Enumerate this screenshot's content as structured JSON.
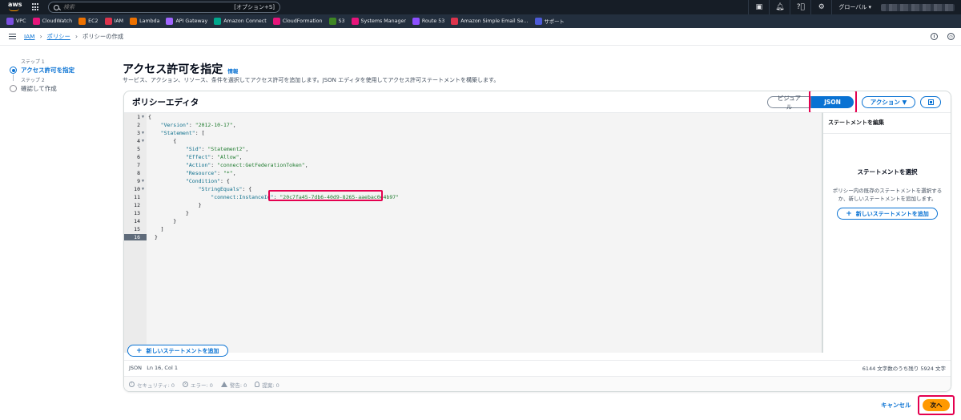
{
  "topbar": {
    "logo": "aws",
    "search_placeholder": "検索",
    "search_shortcut": "[オプション+S]",
    "region": "グローバル ▾"
  },
  "favorites": [
    {
      "label": "VPC",
      "color": "#7b4fe0"
    },
    {
      "label": "CloudWatch",
      "color": "#e7157b"
    },
    {
      "label": "EC2",
      "color": "#ed7100"
    },
    {
      "label": "IAM",
      "color": "#dd344c"
    },
    {
      "label": "Lambda",
      "color": "#ed7100"
    },
    {
      "label": "API Gateway",
      "color": "#a166ff"
    },
    {
      "label": "Amazon Connect",
      "color": "#01a88d"
    },
    {
      "label": "CloudFormation",
      "color": "#e7157b"
    },
    {
      "label": "S3",
      "color": "#3f8624"
    },
    {
      "label": "Systems Manager",
      "color": "#e7157b"
    },
    {
      "label": "Route 53",
      "color": "#8c4fff"
    },
    {
      "label": "Amazon Simple Email Se...",
      "color": "#dd344c"
    },
    {
      "label": "サポート",
      "color": "#4d5bd8"
    }
  ],
  "breadcrumb": {
    "items": [
      "IAM",
      "ポリシー"
    ],
    "current": "ポリシーの作成"
  },
  "steps": {
    "step1_small": "ステップ 1",
    "step1_title": "アクセス許可を指定",
    "step2_small": "ステップ 2",
    "step2_title": "確認して作成"
  },
  "page": {
    "title": "アクセス許可を指定",
    "info_link": "情報",
    "description": "サービス、アクション、リソース、条件を選択してアクセス許可を追加します。JSON エディタを使用してアクセス許可ステートメントを構築します。"
  },
  "editor": {
    "title": "ポリシーエディタ",
    "visual_label": "ビジュアル",
    "json_label": "JSON",
    "actions_label": "アクション ▼",
    "lines": [
      {
        "n": "1",
        "fold": "▼",
        "text": "{"
      },
      {
        "n": "2",
        "fold": "",
        "text": "    \"Version\": \"2012-10-17\","
      },
      {
        "n": "3",
        "fold": "▼",
        "text": "    \"Statement\": ["
      },
      {
        "n": "4",
        "fold": "▼",
        "text": "        {"
      },
      {
        "n": "5",
        "fold": "",
        "text": "            \"Sid\": \"Statement2\","
      },
      {
        "n": "6",
        "fold": "",
        "text": "            \"Effect\": \"Allow\","
      },
      {
        "n": "7",
        "fold": "",
        "text": "            \"Action\": \"connect:GetFederationToken\","
      },
      {
        "n": "8",
        "fold": "",
        "text": "            \"Resource\": \"*\","
      },
      {
        "n": "9",
        "fold": "▼",
        "text": "            \"Condition\": {"
      },
      {
        "n": "10",
        "fold": "▼",
        "text": "                \"StringEquals\": {"
      },
      {
        "n": "11",
        "fold": "",
        "text": "                    \"connect:InstanceId\": \"20c7fa45-7db6-40d9-8265-aaebac0e4b97\""
      },
      {
        "n": "12",
        "fold": "",
        "text": "                }"
      },
      {
        "n": "13",
        "fold": "",
        "text": "            }"
      },
      {
        "n": "14",
        "fold": "",
        "text": "        }"
      },
      {
        "n": "15",
        "fold": "",
        "text": "    ]"
      },
      {
        "n": "16",
        "fold": "",
        "text": "}"
      }
    ],
    "active_line": "16",
    "add_statement_label": "新しいステートメントを追加",
    "status_left": "JSON   Ln 16, Col 1",
    "status_right": "6144 文字数のうち残り 5924 文字",
    "diagnostics": {
      "security": "セキュリティ: 0",
      "errors": "エラー: 0",
      "warnings": "警告: 0",
      "suggestions": "提案: 0"
    }
  },
  "side_panel": {
    "title": "ステートメントを編集",
    "subtitle": "ステートメントを選択",
    "description": "ポリシー内の既存のステートメントを選択するか、新しいステートメントを追加します。",
    "add_label": "新しいステートメントを追加"
  },
  "footer": {
    "cancel_label": "キャンセル",
    "next_label": "次へ"
  }
}
